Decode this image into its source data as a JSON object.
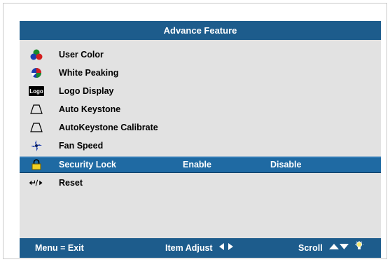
{
  "window": {
    "title": "Advance Feature"
  },
  "menu": {
    "items": [
      {
        "label": "User Color",
        "icon": "user-color-icon"
      },
      {
        "label": "White Peaking",
        "icon": "white-peaking-icon"
      },
      {
        "label": "Logo Display",
        "icon": "logo-display-icon",
        "badge": "Logo"
      },
      {
        "label": "Auto Keystone",
        "icon": "keystone-icon"
      },
      {
        "label": "AutoKeystone Calibrate",
        "icon": "keystone-calibrate-icon"
      },
      {
        "label": "Fan Speed",
        "icon": "fan-icon"
      },
      {
        "label": "Security Lock",
        "icon": "lock-icon",
        "selected": true
      },
      {
        "label": "Reset",
        "icon": "reset-icon"
      }
    ],
    "security_lock_options": {
      "enable": "Enable",
      "disable": "Disable"
    }
  },
  "footer": {
    "menu_exit": "Menu = Exit",
    "item_adjust": "Item Adjust",
    "scroll": "Scroll"
  },
  "colors": {
    "accent": "#1d5c8c",
    "selection": "#1f6aa3",
    "panel_bg": "#e2e2e2"
  }
}
